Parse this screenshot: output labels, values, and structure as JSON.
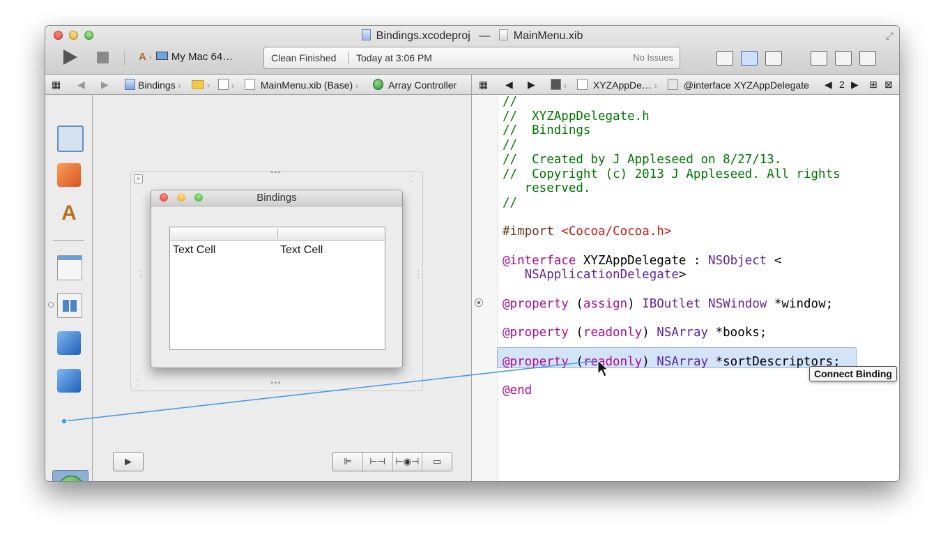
{
  "window": {
    "title_project": "Bindings.xcodeproj",
    "title_sep": "—",
    "title_file": "MainMenu.xib"
  },
  "toolbar": {
    "scheme_target": "My Mac 64…",
    "activity_status": "Clean Finished",
    "activity_time": "Today at 3:06 PM",
    "activity_issues": "No Issues"
  },
  "jumpbar_left": {
    "items": [
      "Bindings",
      "MainMenu.xib (Base)",
      "Array Controller"
    ]
  },
  "jumpbar_right": {
    "items": [
      "XYZAppDe…",
      "@interface XYZAppDelegate"
    ],
    "counter": "2"
  },
  "canvas": {
    "window_title": "Bindings",
    "cells": [
      "Text Cell",
      "Text Cell"
    ]
  },
  "editor": {
    "lines": [
      "//",
      "//  XYZAppDelegate.h",
      "//  Bindings",
      "//",
      "//  Created by J Appleseed on 8/27/13.",
      "//  Copyright (c) 2013 J Appleseed. All rights",
      "   reserved.",
      "//",
      "",
      "#import <Cocoa/Cocoa.h>",
      "",
      "@interface XYZAppDelegate : NSObject <",
      "   NSApplicationDelegate>",
      "",
      "@property (assign) IBOutlet NSWindow *window;",
      "",
      "@property (readonly) NSArray *books;",
      "",
      "@property (readonly) NSArray *sortDescriptors;",
      "",
      "@end"
    ],
    "tooltip": "Connect Binding"
  },
  "colors": {
    "comment": "#007400",
    "keyword": "#aa0d91",
    "class": "#5c2699",
    "string": "#c41a16",
    "connection_line": "#4a9ae6"
  }
}
